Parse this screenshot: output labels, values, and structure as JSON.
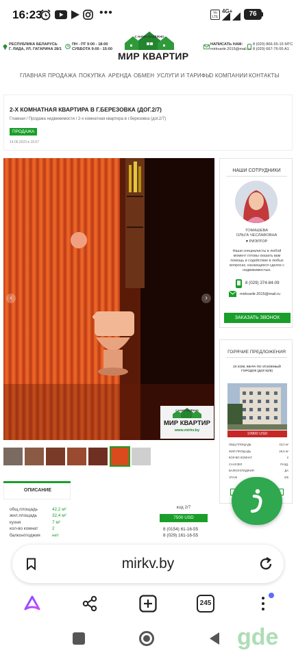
{
  "status_bar": {
    "time": "16:23",
    "battery": "76",
    "network": "4G+",
    "volte": "Vo LTE",
    "icons": [
      "alarm-icon",
      "youtube-icon",
      "play-icon",
      "instagram-icon",
      "more-icon"
    ]
  },
  "header": {
    "address_line1": "РЕСПУБЛИКА БЕЛАРУСЬ",
    "address_line2": "Г. ЛИДА, УЛ. ГАГАРИНА 28/1",
    "hours_line1": "ПН - ПТ 9:00 - 18:00",
    "hours_line2": "СУББОТА 9:00 - 15:00",
    "logo_arc": "С НАМИ НАДЁЖНО",
    "logo_title": "МИР КВАРТИР",
    "write_line1": "НАПИСАТЬ НАМ:",
    "write_line2": "mirkvartir.2015@mail.ru",
    "phone1": "8 (029) 866-55-15 МТС",
    "phone2": "8 (029) 667-76-55 A1"
  },
  "nav": {
    "items": [
      "ГЛАВНАЯ",
      "ПРОДАЖА",
      "ПОКУПКА",
      "АРЕНДА",
      "ОБМЕН",
      "УСЛУГИ И ТАРИФЫ",
      "О КОМПАНИИ",
      "КОНТАКТЫ"
    ]
  },
  "listing": {
    "title": "2-Х КОМНАТНАЯ КВАРТИРА В Г.БЕРЕЗОВКА (ДОГ.2/7)",
    "breadcrumb": "Главная / Продажа недвижимости / 2-х комнатная квартира в г.березовка (дог.2/7)",
    "badge": "ПРОДАЖА",
    "date": "14.06.2023 в 15:57",
    "photo_watermark_arc": "С НАМИ НАДЁЖНО",
    "photo_watermark_title": "МИР КВАРТИР",
    "photo_watermark_url": "www.mirkv.by",
    "code_label": "код 2/7",
    "price": "7500 USD",
    "phones": [
      "8 (0154) 61-16-55",
      "8 (029) 161-16-55"
    ],
    "thumbnails": 7,
    "selected_thumbnail": 6
  },
  "description": {
    "heading": "ОПИСАНИЕ",
    "rows": [
      {
        "label": "общ.площадь",
        "value": "42,2 м²"
      },
      {
        "label": "жил.площадь",
        "value": "32,4 м²"
      },
      {
        "label": "кухня",
        "value": "7 м²"
      },
      {
        "label": "кол-во комнат",
        "value": "2"
      },
      {
        "label": "балкон/лоджия",
        "value": "нет"
      }
    ]
  },
  "staff": {
    "heading": "НАШИ СОТРУДНИКИ",
    "name_line1": "ТОМАШЕВА",
    "name_line2": "ОЛЬГА ЧЕСЛАВОВНА",
    "role": "♥ РИЭЛТОР",
    "about": "Наши специалисты в любой момент готовы оказать вам помощь и содействие в любых вопросах, касающихся сделок с недвижимостью.",
    "phone": "8 (029) 374-84-09",
    "email": "mirkvartir.2015@mail.ru",
    "call_button": "ЗАКАЗАТЬ ЗВОНОК"
  },
  "hot": {
    "heading": "ГОРЯЧИЕ ПРЕДЛОЖЕНИЯ",
    "item_title": "2Х КОМ. КВ-РА ПО УЛ.ЮЖНЫЙ ГОРОДОК (ДОГ.52/6)",
    "price": "10900 USD",
    "rows": [
      {
        "label": "ОБЩ.ПЛОЩАДЬ",
        "value": "43,0 м²"
      },
      {
        "label": "ЖИЛ.ПЛОЩАДЬ",
        "value": "28,6 м²"
      },
      {
        "label": "КОЛ-ВО КОМНАТ",
        "value": "2"
      },
      {
        "label": "САНУЗЕЛ",
        "value": "РАЗД."
      },
      {
        "label": "БАЛКОН/ЛОДЖИЯ",
        "value": "ДА"
      },
      {
        "label": "ЭТАЖ",
        "value": "5/5"
      }
    ]
  },
  "browser": {
    "url": "mirkv.by",
    "tab_count": "245"
  },
  "colors": {
    "brand_green": "#1a9e2a",
    "price_red": "#c62828",
    "fab_green": "#2fa84f"
  }
}
